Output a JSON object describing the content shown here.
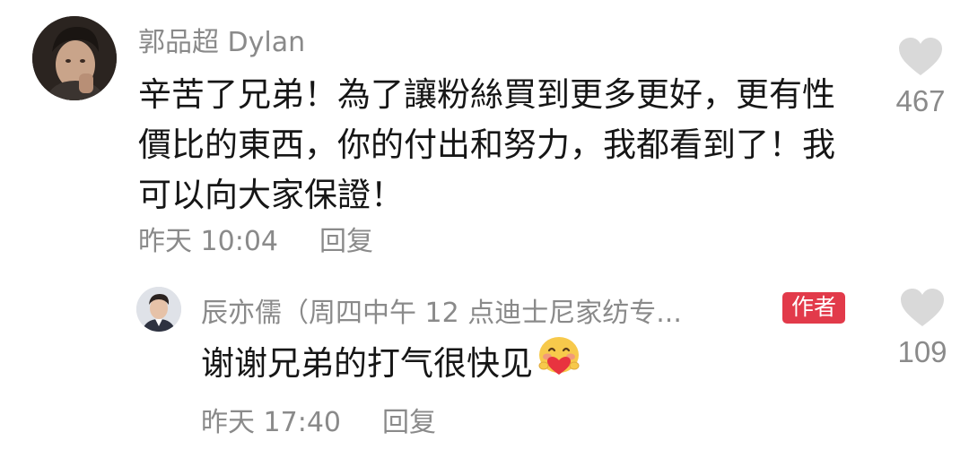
{
  "main_comment": {
    "author": "郭品超 Dylan",
    "text": "辛苦了兄弟！為了讓粉絲買到更多更好，更有性價比的東西，你的付出和努力，我都看到了！我可以向大家保證！",
    "timestamp": "昨天 10:04",
    "reply_label": "回复",
    "like_count": "467",
    "avatar_icon": "avatar-male-photo"
  },
  "reply_comment": {
    "author": "辰亦儒（周四中午 12 点迪士尼家纺专...",
    "badge": "作者",
    "text": "谢谢兄弟的打气很快见",
    "emoji_icon": "smiling-face-with-heart-emoji",
    "timestamp": "昨天 17:40",
    "reply_label": "回复",
    "like_count": "109",
    "avatar_icon": "avatar-male-photo"
  },
  "colors": {
    "meta_gray": "#8a8a8a",
    "text_dark": "#161616",
    "heart_gray": "#d9d9d9",
    "badge_red": "#e23a4a"
  }
}
